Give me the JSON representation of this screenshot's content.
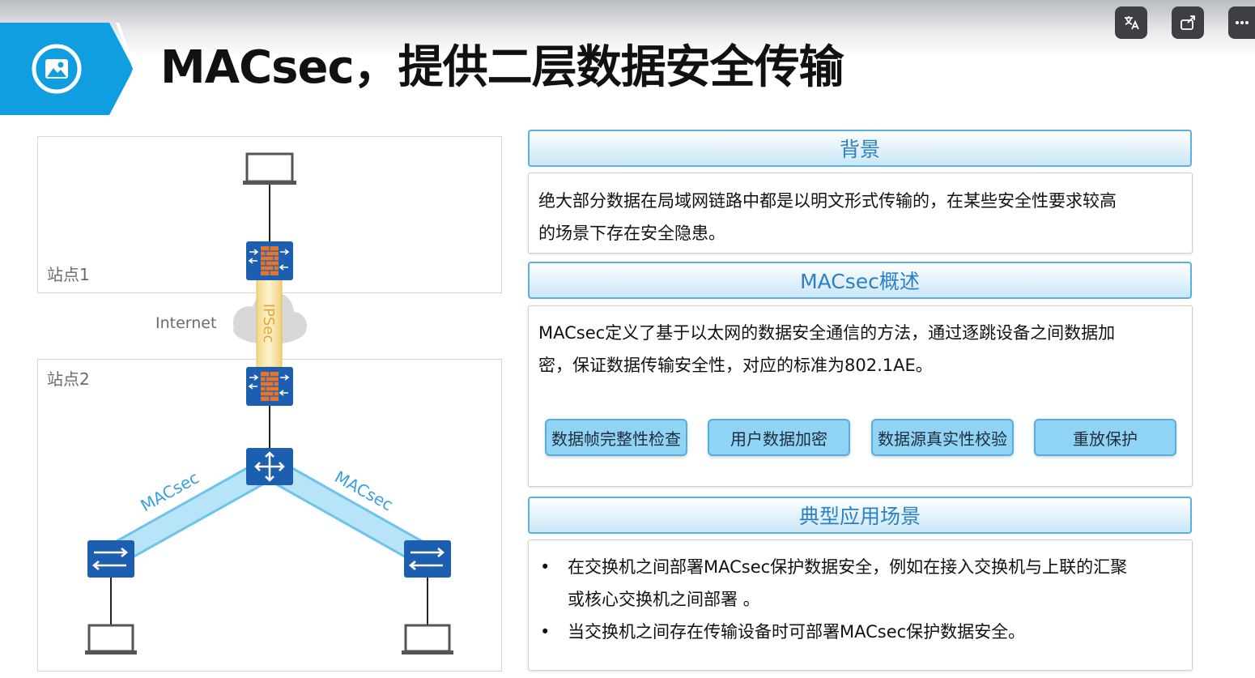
{
  "header": {
    "title": "MACsec，提供二层数据安全传输",
    "logo_icon": "image-icon",
    "controls": [
      {
        "name": "translate-icon"
      },
      {
        "name": "share-icon"
      },
      {
        "name": "more-icon"
      }
    ]
  },
  "diagram": {
    "site1_label": "站点1",
    "site2_label": "站点2",
    "internet_label": "Internet",
    "ipsec_label": "IPSec",
    "macsec_left_label": "MACsec",
    "macsec_right_label": "MACsec",
    "colors": {
      "device_blue": "#1c5fb0",
      "tunnel_blue": "#a8dcf5",
      "ipsec_yellow": "#f7e3a0",
      "firewall_orange": "#e5742e"
    }
  },
  "background": {
    "heading": "背景",
    "text_line1": "绝大部分数据在局域网链路中都是以明文形式传输的，在某些安全性要求较高",
    "text_line2": "的场景下存在安全隐患。"
  },
  "overview": {
    "heading": "MACsec概述",
    "text_line1": "MACsec定义了基于以太网的数据安全通信的方法，通过逐跳设备之间数据加",
    "text_line2": "密，保证数据传输安全性，对应的标准为802.1AE。",
    "features": [
      "数据帧完整性检查",
      "用户数据加密",
      "数据源真实性校验",
      "重放保护"
    ]
  },
  "scenarios": {
    "heading": "典型应用场景",
    "bullet_symbol": "•",
    "item1_line1": "在交换机之间部署MACsec保护数据安全，例如在接入交换机与上联的汇聚",
    "item1_line2": "或核心交换机之间部署 。",
    "item2_line1": "当交换机之间存在传输设备时可部署MACsec保护数据安全。"
  }
}
